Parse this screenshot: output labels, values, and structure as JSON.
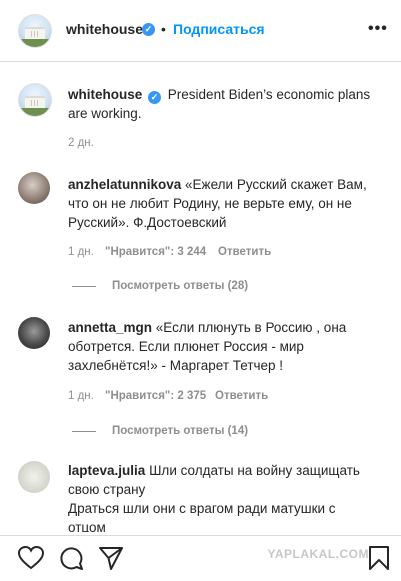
{
  "header": {
    "username": "whitehouse",
    "dot": "•",
    "follow_label": "Подписаться",
    "more_label": "•••"
  },
  "caption": {
    "username": "whitehouse",
    "text": "President Biden’s economic plans are working.",
    "time": "2 дн."
  },
  "comments": [
    {
      "username": "anzhelatunnikova",
      "text": "«Ежели Русский скажет Вам, что он не любит Родину, не верьте ему, он не Русский». Ф.Достоевский",
      "time": "1 дн.",
      "likes": "\"Нравится\": 3 244",
      "reply_label": "Ответить",
      "view_replies": "Посмотреть ответы (28)"
    },
    {
      "username": "annetta_mgn",
      "text": "«Если плюнуть в Россию , она оботрется. Если плюнет Россия - мир захлебнётся!» - Маргарет Тетчер !",
      "time": "1 дн.",
      "likes": "\"Нравится\": 2 375",
      "reply_label": "Ответить",
      "view_replies": "Посмотреть ответы (14)"
    },
    {
      "username": "lapteva.julia",
      "text_line1": "Шли солдаты на войну защищать",
      "text_line2": "свою страну",
      "text_line3": "Драться шли они с врагом ради матушки с",
      "text_line4": "отцом"
    }
  ],
  "footer": {
    "watermark": "YAPLAKAL.COM"
  },
  "icons": [
    "heart-icon",
    "comment-icon",
    "share-icon",
    "bookmark-icon",
    "verified-icon",
    "more-options-icon"
  ],
  "colors": {
    "accent": "#0095f6",
    "verified": "#3897f0",
    "muted": "#8e8e8e",
    "text": "#262626"
  }
}
